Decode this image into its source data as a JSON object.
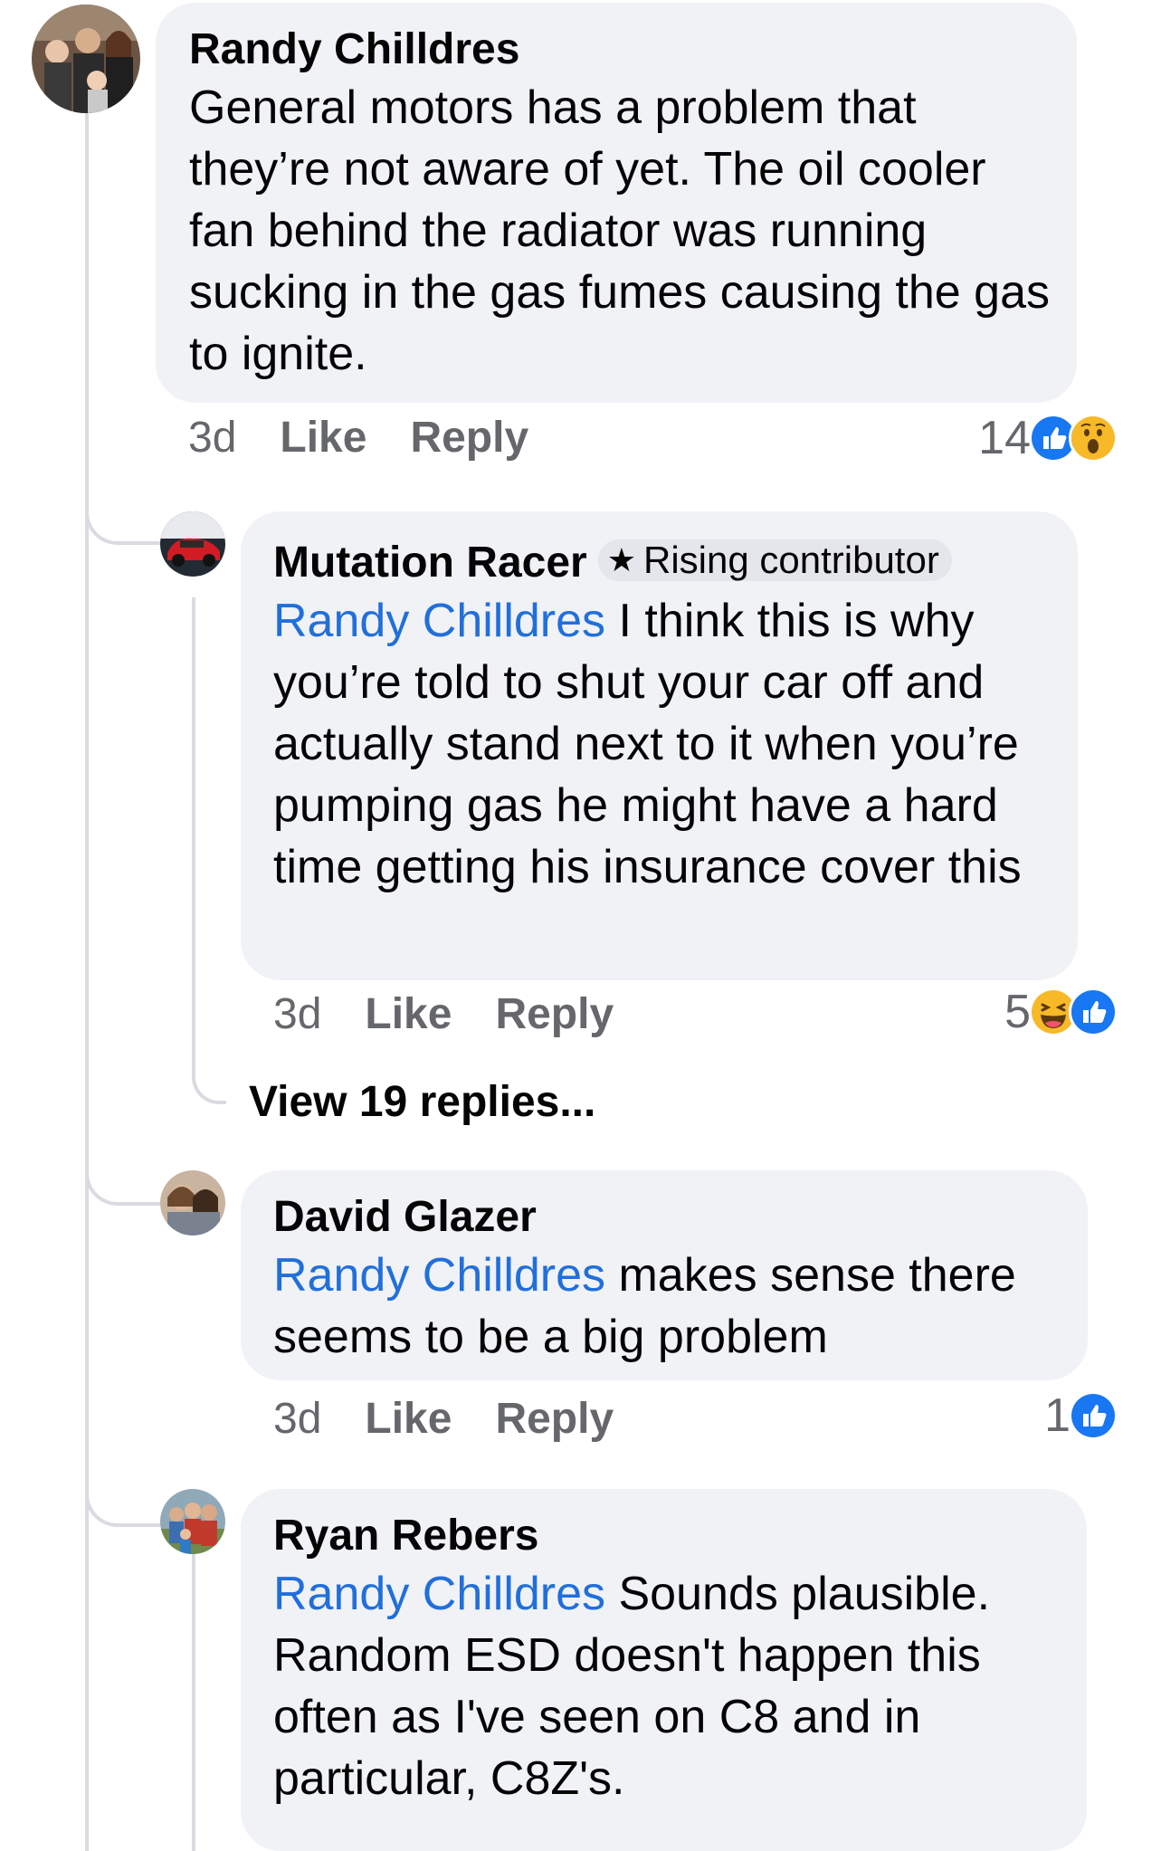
{
  "comments": [
    {
      "author": "Randy Chilldres",
      "mention": "",
      "text": "General motors has a problem that they’re not aware of yet. The oil cooler fan behind the radiator was running sucking in the gas fumes causing the gas to ignite.",
      "time": "3d",
      "like_label": "Like",
      "reply_label": "Reply",
      "reaction_count": "14",
      "reactions": [
        "like-reaction-icon",
        "wow-reaction-icon"
      ]
    },
    {
      "author": "Mutation Racer",
      "badge": "Rising contributor",
      "badge_icon": "star-icon",
      "mention": "Randy Chilldres",
      "text": " I think this is why you’re told to shut your car off and actually stand next to it when you’re pumping gas he might have a hard time getting his insurance cover this",
      "time": "3d",
      "like_label": "Like",
      "reply_label": "Reply",
      "reaction_count": "5",
      "reactions": [
        "haha-reaction-icon",
        "like-reaction-icon"
      ],
      "view_replies": "View 19 replies..."
    },
    {
      "author": "David Glazer",
      "mention": "Randy Chilldres",
      "text": " makes sense there seems to be a big problem",
      "time": "3d",
      "like_label": "Like",
      "reply_label": "Reply",
      "reaction_count": "1",
      "reactions": [
        "like-reaction-icon"
      ]
    },
    {
      "author": "Ryan Rebers",
      "mention": "Randy Chilldres",
      "text": " Sounds plausible. Random ESD doesn't happen this often as I've seen on C8 and in particular, C8Z's."
    }
  ],
  "colors": {
    "bubble": "#f0f2f5",
    "mention": "#216fdb",
    "meta": "#65676b",
    "like_blue": "#1877f2",
    "reaction_yellow": "#f7b928"
  }
}
